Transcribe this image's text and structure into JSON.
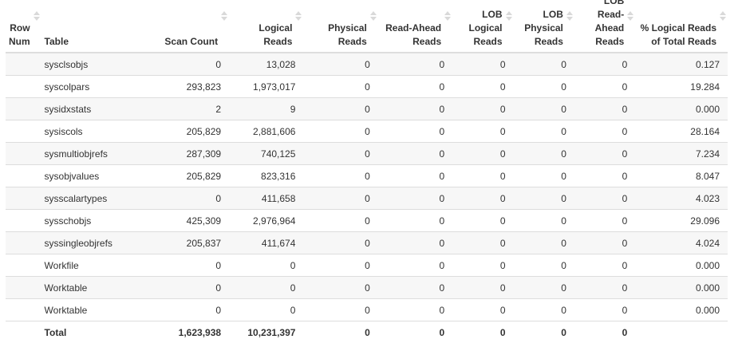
{
  "columns": [
    {
      "key": "row_num",
      "label": "Row Num",
      "align": "right"
    },
    {
      "key": "table",
      "label": "Table",
      "align": "left"
    },
    {
      "key": "scan_count",
      "label": "Scan Count",
      "align": "right"
    },
    {
      "key": "logical_reads",
      "label": "Logical Reads",
      "align": "right"
    },
    {
      "key": "physical_reads",
      "label": "Physical Reads",
      "align": "right"
    },
    {
      "key": "read_ahead_reads",
      "label": "Read-Ahead Reads",
      "align": "right"
    },
    {
      "key": "lob_logical_reads",
      "label": "LOB Logical Reads",
      "align": "right"
    },
    {
      "key": "lob_physical_reads",
      "label": "LOB Physical Reads",
      "align": "right"
    },
    {
      "key": "lob_read_ahead_reads",
      "label": "LOB Read-Ahead Reads",
      "align": "right"
    },
    {
      "key": "pct_logical_reads",
      "label": "% Logical Reads of Total Reads",
      "align": "right"
    }
  ],
  "sorted_column": "table",
  "sort_direction": "ascending",
  "rows": [
    {
      "row_num": "",
      "table": "sysclsobjs",
      "scan_count": "0",
      "logical_reads": "13,028",
      "physical_reads": "0",
      "read_ahead_reads": "0",
      "lob_logical_reads": "0",
      "lob_physical_reads": "0",
      "lob_read_ahead_reads": "0",
      "pct_logical_reads": "0.127"
    },
    {
      "row_num": "",
      "table": "syscolpars",
      "scan_count": "293,823",
      "logical_reads": "1,973,017",
      "physical_reads": "0",
      "read_ahead_reads": "0",
      "lob_logical_reads": "0",
      "lob_physical_reads": "0",
      "lob_read_ahead_reads": "0",
      "pct_logical_reads": "19.284"
    },
    {
      "row_num": "",
      "table": "sysidxstats",
      "scan_count": "2",
      "logical_reads": "9",
      "physical_reads": "0",
      "read_ahead_reads": "0",
      "lob_logical_reads": "0",
      "lob_physical_reads": "0",
      "lob_read_ahead_reads": "0",
      "pct_logical_reads": "0.000"
    },
    {
      "row_num": "",
      "table": "sysiscols",
      "scan_count": "205,829",
      "logical_reads": "2,881,606",
      "physical_reads": "0",
      "read_ahead_reads": "0",
      "lob_logical_reads": "0",
      "lob_physical_reads": "0",
      "lob_read_ahead_reads": "0",
      "pct_logical_reads": "28.164"
    },
    {
      "row_num": "",
      "table": "sysmultiobjrefs",
      "scan_count": "287,309",
      "logical_reads": "740,125",
      "physical_reads": "0",
      "read_ahead_reads": "0",
      "lob_logical_reads": "0",
      "lob_physical_reads": "0",
      "lob_read_ahead_reads": "0",
      "pct_logical_reads": "7.234"
    },
    {
      "row_num": "",
      "table": "sysobjvalues",
      "scan_count": "205,829",
      "logical_reads": "823,316",
      "physical_reads": "0",
      "read_ahead_reads": "0",
      "lob_logical_reads": "0",
      "lob_physical_reads": "0",
      "lob_read_ahead_reads": "0",
      "pct_logical_reads": "8.047"
    },
    {
      "row_num": "",
      "table": "sysscalartypes",
      "scan_count": "0",
      "logical_reads": "411,658",
      "physical_reads": "0",
      "read_ahead_reads": "0",
      "lob_logical_reads": "0",
      "lob_physical_reads": "0",
      "lob_read_ahead_reads": "0",
      "pct_logical_reads": "4.023"
    },
    {
      "row_num": "",
      "table": "sysschobjs",
      "scan_count": "425,309",
      "logical_reads": "2,976,964",
      "physical_reads": "0",
      "read_ahead_reads": "0",
      "lob_logical_reads": "0",
      "lob_physical_reads": "0",
      "lob_read_ahead_reads": "0",
      "pct_logical_reads": "29.096"
    },
    {
      "row_num": "",
      "table": "syssingleobjrefs",
      "scan_count": "205,837",
      "logical_reads": "411,674",
      "physical_reads": "0",
      "read_ahead_reads": "0",
      "lob_logical_reads": "0",
      "lob_physical_reads": "0",
      "lob_read_ahead_reads": "0",
      "pct_logical_reads": "4.024"
    },
    {
      "row_num": "",
      "table": "Workfile",
      "scan_count": "0",
      "logical_reads": "0",
      "physical_reads": "0",
      "read_ahead_reads": "0",
      "lob_logical_reads": "0",
      "lob_physical_reads": "0",
      "lob_read_ahead_reads": "0",
      "pct_logical_reads": "0.000"
    },
    {
      "row_num": "",
      "table": "Worktable",
      "scan_count": "0",
      "logical_reads": "0",
      "physical_reads": "0",
      "read_ahead_reads": "0",
      "lob_logical_reads": "0",
      "lob_physical_reads": "0",
      "lob_read_ahead_reads": "0",
      "pct_logical_reads": "0.000"
    },
    {
      "row_num": "",
      "table": "Worktable",
      "scan_count": "0",
      "logical_reads": "0",
      "physical_reads": "0",
      "read_ahead_reads": "0",
      "lob_logical_reads": "0",
      "lob_physical_reads": "0",
      "lob_read_ahead_reads": "0",
      "pct_logical_reads": "0.000"
    }
  ],
  "total": {
    "row_num": "",
    "table": "Total",
    "scan_count": "1,623,938",
    "logical_reads": "10,231,397",
    "physical_reads": "0",
    "read_ahead_reads": "0",
    "lob_logical_reads": "0",
    "lob_physical_reads": "0",
    "lob_read_ahead_reads": "0",
    "pct_logical_reads": ""
  },
  "colors": {
    "sort_active": "#7a8fc0",
    "sort_inactive": "#d9d9d9",
    "stripe": "#f7f7f7",
    "border": "#dddddd"
  },
  "icons": {
    "sort_inactive": "sort-both-icon",
    "sort_active": "sort-ascending-icon"
  }
}
